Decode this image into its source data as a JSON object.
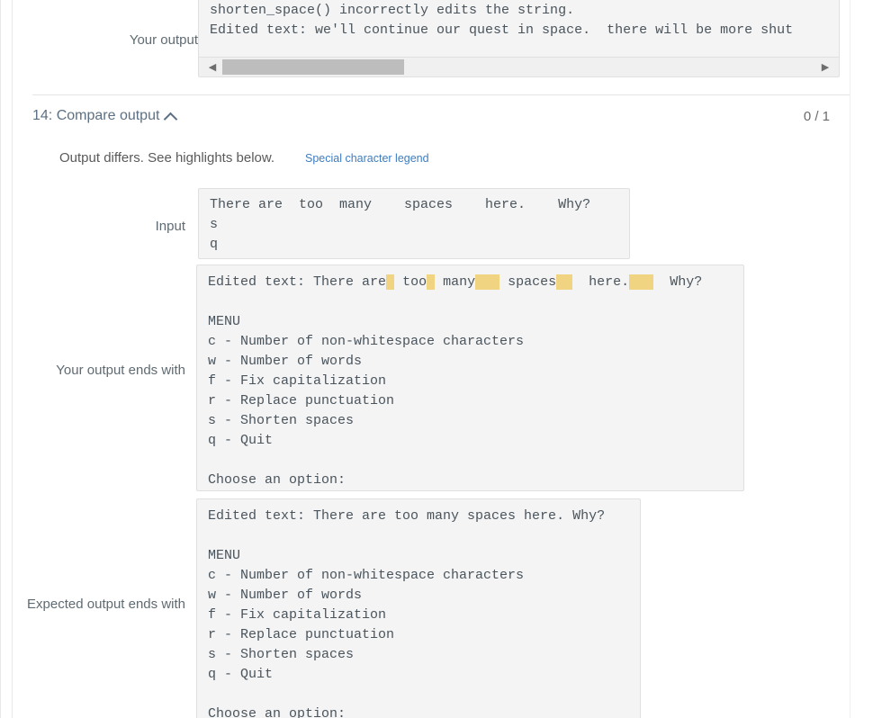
{
  "left_rules": {
    "color": "#e8e8e8"
  },
  "top_section": {
    "label": "Your output",
    "output_text": "shorten_space() incorrectly edits the string.\nEdited text: we'll continue our quest in space.  there will be more shut",
    "scrollbar": {
      "left_arrow": "◀",
      "right_arrow": "▶",
      "thumb_color": "#bdbdbd"
    }
  },
  "section": {
    "title": "14: Compare output",
    "collapse_icon": "chevron-up",
    "score": "0 / 1",
    "diff_message": "Output differs. See highlights below.",
    "legend_link": "Special character legend",
    "link_color": "#3e7dc0"
  },
  "input_row": {
    "label": "Input",
    "text": "There are  too  many    spaces    here.    Why?\ns\nq"
  },
  "your_output_ends_with": {
    "label": "Your output ends with",
    "highlight_color": "#f0d481",
    "first_line_segments": [
      {
        "text": "Edited text: There are",
        "highlight": false
      },
      {
        "text": " ",
        "highlight": true
      },
      {
        "text": " too",
        "highlight": false
      },
      {
        "text": " ",
        "highlight": true
      },
      {
        "text": " many",
        "highlight": false
      },
      {
        "text": "   ",
        "highlight": true
      },
      {
        "text": " spaces",
        "highlight": false
      },
      {
        "text": "  ",
        "highlight": true
      },
      {
        "text": "  here.",
        "highlight": false
      },
      {
        "text": "   ",
        "highlight": true
      },
      {
        "text": "  Why?",
        "highlight": false
      }
    ],
    "rest_text": "\n\nMENU\nc - Number of non-whitespace characters\nw - Number of words\nf - Fix capitalization\nr - Replace punctuation\ns - Shorten spaces\nq - Quit\n\nChoose an option:"
  },
  "expected_output_ends_with": {
    "label": "Expected output ends with",
    "text": "Edited text: There are too many spaces here. Why?\n\nMENU\nc - Number of non-whitespace characters\nw - Number of words\nf - Fix capitalization\nr - Replace punctuation\ns - Shorten spaces\nq - Quit\n\nChoose an option:"
  }
}
